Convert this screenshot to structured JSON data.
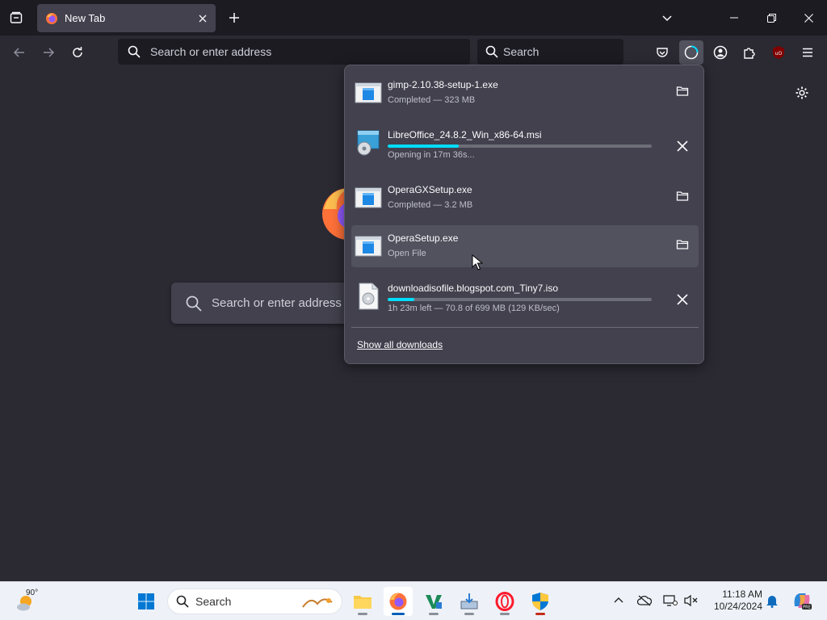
{
  "browser": {
    "tab": {
      "title": "New Tab"
    },
    "urlbar": {
      "placeholder": "Search or enter address"
    },
    "searchbar": {
      "placeholder": "Search"
    },
    "newtab_search": {
      "placeholder": "Search or enter address"
    }
  },
  "downloads_panel": {
    "items": [
      {
        "name": "gimp-2.10.38-setup-1.exe",
        "status": "Completed — 323 MB",
        "icon": "exe-file-icon",
        "action": "folder-icon"
      },
      {
        "name": "LibreOffice_24.8.2_Win_x86-64.msi",
        "status": "Opening in 17m 36s...",
        "icon": "msi-installer-icon",
        "action": "cancel-icon",
        "progress": 0.27
      },
      {
        "name": "OperaGXSetup.exe",
        "status": "Completed — 3.2 MB",
        "icon": "exe-file-icon",
        "action": "folder-icon"
      },
      {
        "name": "OperaSetup.exe",
        "status": "Open File",
        "icon": "exe-file-icon",
        "action": "folder-icon"
      },
      {
        "name": "downloadisofile.blogspot.com_Tiny7.iso",
        "status": "1h 23m left — 70.8 of 699 MB (129 KB/sec)",
        "icon": "iso-file-icon",
        "action": "cancel-icon",
        "progress": 0.1
      }
    ],
    "show_all_label": "Show all downloads"
  },
  "taskbar": {
    "weather_temp": "90°",
    "search_placeholder": "Search",
    "time": "11:18 AM",
    "date": "10/24/2024"
  },
  "colors": {
    "accent": "#00ddff",
    "panel_bg": "#42414d",
    "content_bg": "#2b2a33"
  }
}
